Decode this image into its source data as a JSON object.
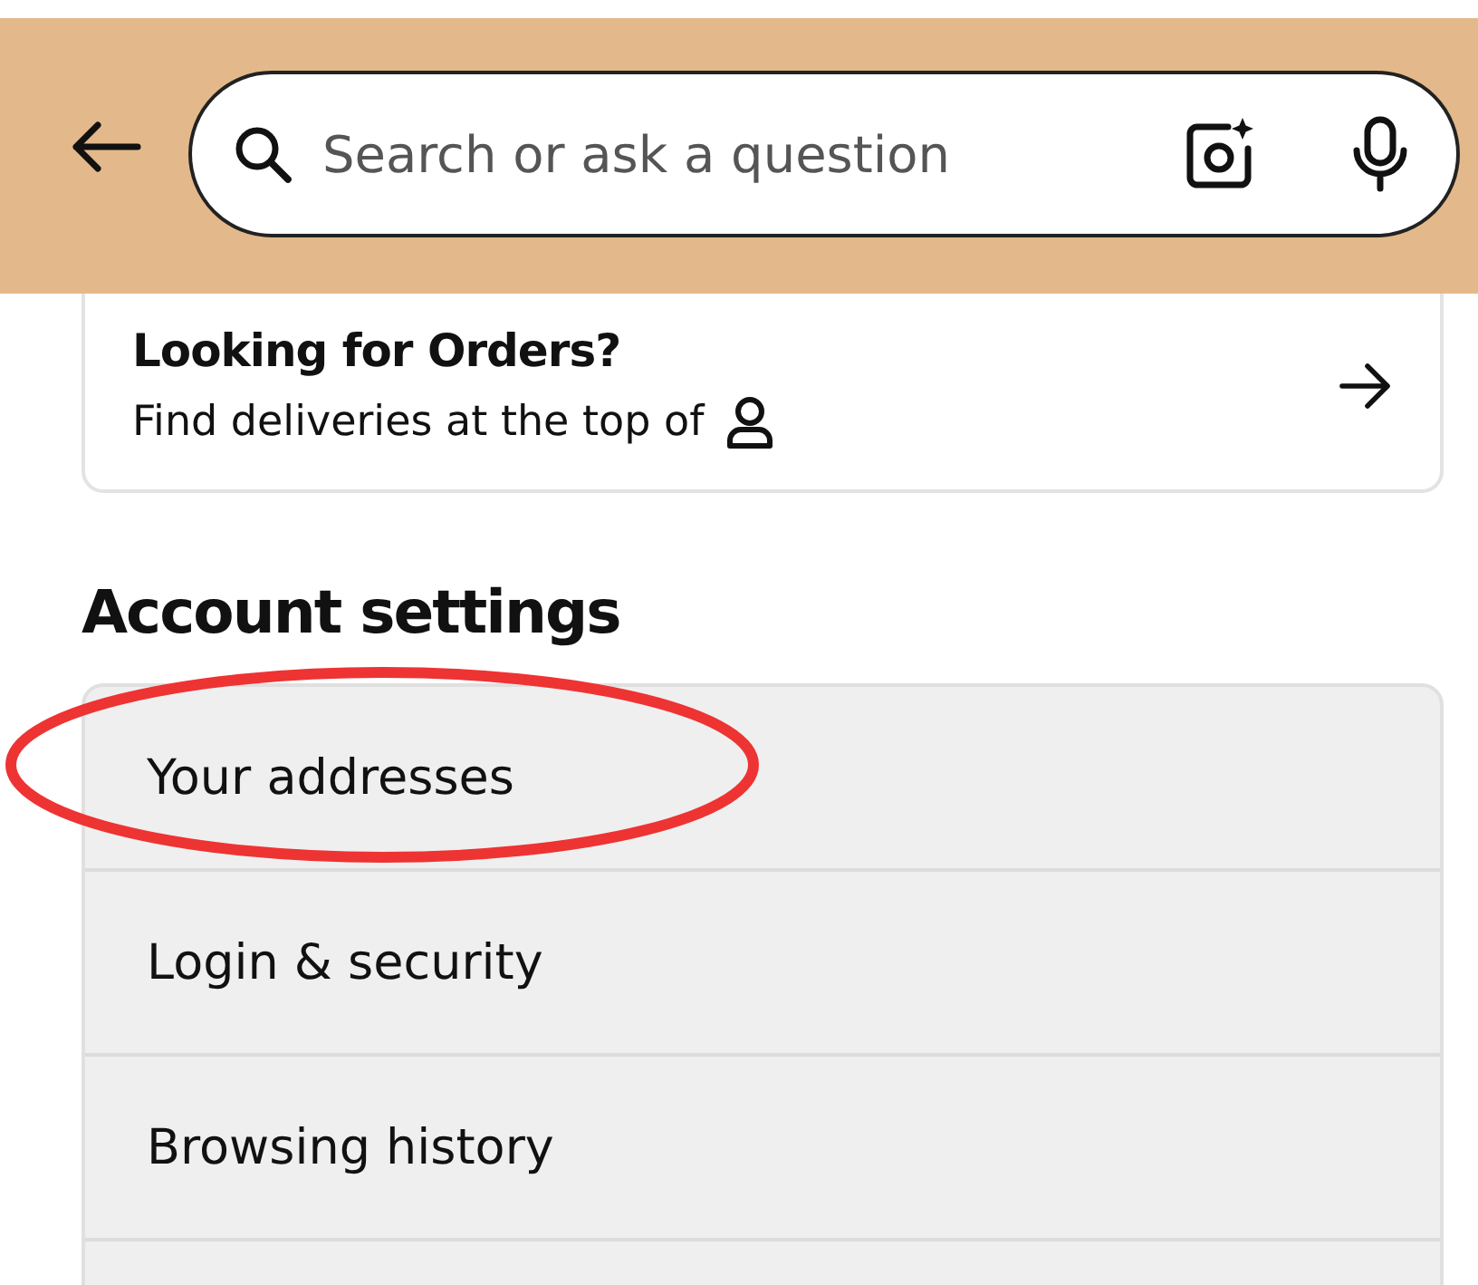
{
  "header": {
    "search": {
      "placeholder": "Search or ask a question"
    }
  },
  "orders_card": {
    "title": "Looking for Orders?",
    "subtitle": "Find deliveries at the top of"
  },
  "section_title": "Account settings",
  "settings_items": [
    {
      "label": "Your addresses",
      "circled": true
    },
    {
      "label": "Login & security",
      "circled": false
    },
    {
      "label": "Browsing history",
      "circled": false
    }
  ]
}
